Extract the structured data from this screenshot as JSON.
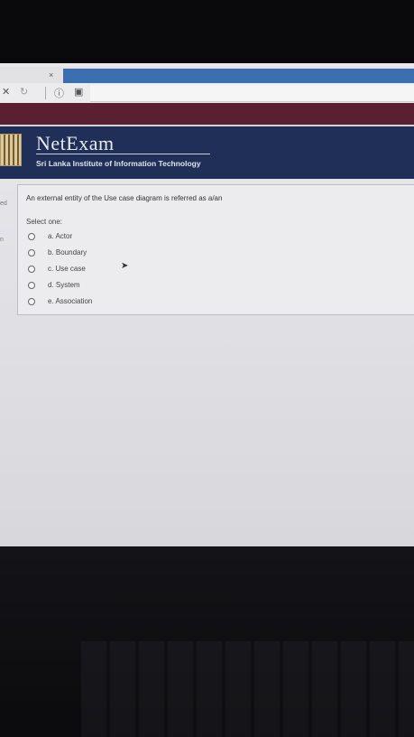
{
  "browser": {
    "tab_close": "×",
    "toolbar_icons": [
      "close-icon",
      "refresh-icon",
      "info-icon",
      "page-icon"
    ]
  },
  "site": {
    "brand": "NetExam",
    "subtitle": "Sri Lanka Institute of Information Technology",
    "header_color": "#1f2f57"
  },
  "side": {
    "label_1": "ed",
    "label_2": "n"
  },
  "question": {
    "text": "An external entity of the Use case diagram is referred as a/an",
    "prompt": "Select one:",
    "options": [
      {
        "label": "a. Actor"
      },
      {
        "label": "b. Boundary"
      },
      {
        "label": "c. Use case"
      },
      {
        "label": "d. System"
      },
      {
        "label": "e. Association"
      }
    ]
  }
}
